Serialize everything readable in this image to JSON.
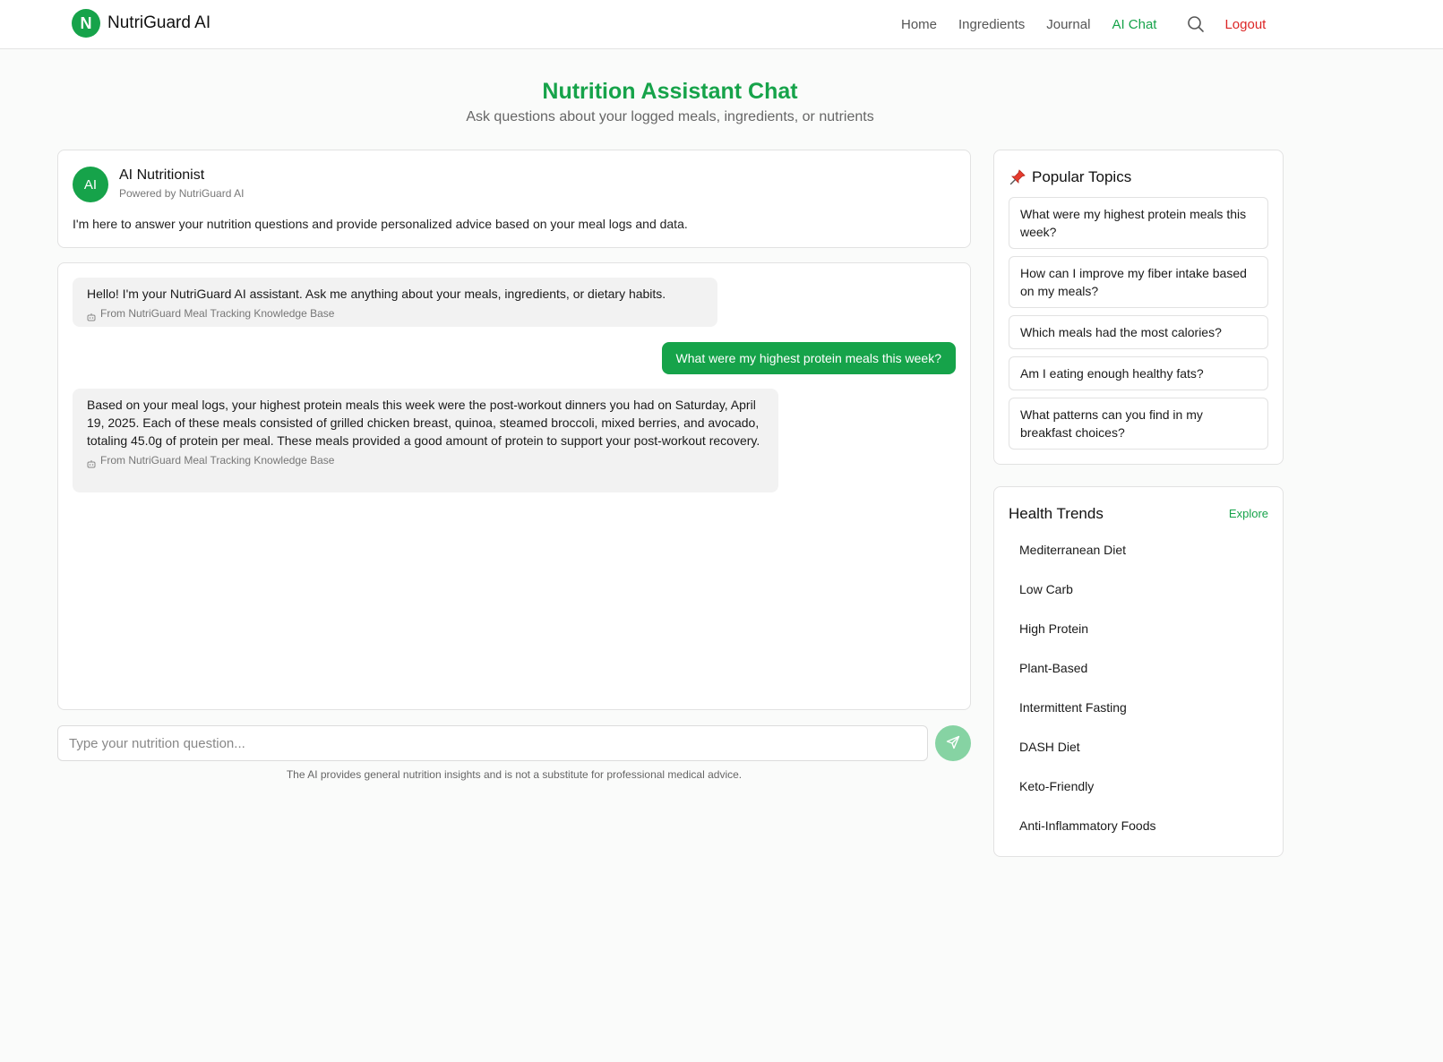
{
  "header": {
    "logo_letter": "N",
    "brand": "NutriGuard AI",
    "nav": [
      "Home",
      "Ingredients",
      "Journal",
      "AI Chat"
    ],
    "active_nav": "AI Chat",
    "search_icon": "search-icon",
    "logout": "Logout"
  },
  "page": {
    "title": "Nutrition Assistant Chat",
    "subtitle": "Ask questions about your logged meals, ingredients, or nutrients"
  },
  "assistant": {
    "avatar": "AI",
    "name": "AI Nutritionist",
    "powered_by": "Powered by NutriGuard AI",
    "description": "I'm here to answer your nutrition questions and provide personalized advice based on your meal logs and data."
  },
  "chat": {
    "messages": [
      {
        "role": "bot",
        "text": "Hello! I'm your NutriGuard AI assistant. Ask me anything about your meals, ingredients, or dietary habits.",
        "source": "From NutriGuard Meal Tracking Knowledge Base"
      },
      {
        "role": "user",
        "text": "What were my highest protein meals this week?"
      },
      {
        "role": "bot",
        "text": "Based on your meal logs, your highest protein meals this week were the post-workout dinners you had on Saturday, April 19, 2025. Each of these meals consisted of grilled chicken breast, quinoa, steamed broccoli, mixed berries, and avocado, totaling 45.0g of protein per meal. These meals provided a good amount of protein to support your post-workout recovery.",
        "source": "From NutriGuard Meal Tracking Knowledge Base"
      }
    ],
    "input_placeholder": "Type your nutrition question...",
    "send_icon": "send-icon",
    "disclaimer": "The AI provides general nutrition insights and is not a substitute for professional medical advice."
  },
  "popular_topics": {
    "title": "Popular Topics",
    "icon": "pushpin-icon",
    "items": [
      "What were my highest protein meals this week?",
      "How can I improve my fiber intake based on my meals?",
      "Which meals had the most calories?",
      "Am I eating enough healthy fats?",
      "What patterns can you find in my breakfast choices?"
    ]
  },
  "health_trends": {
    "title": "Health Trends",
    "explore": "Explore",
    "items": [
      "Mediterranean Diet",
      "Low Carb",
      "High Protein",
      "Plant-Based",
      "Intermittent Fasting",
      "DASH Diet",
      "Keto-Friendly",
      "Anti-Inflammatory Foods"
    ]
  },
  "colors": {
    "accent": "#16a34a",
    "send_button": "#86d3a3",
    "logout": "#dc2626",
    "bot_bubble": "#f2f2f2"
  }
}
